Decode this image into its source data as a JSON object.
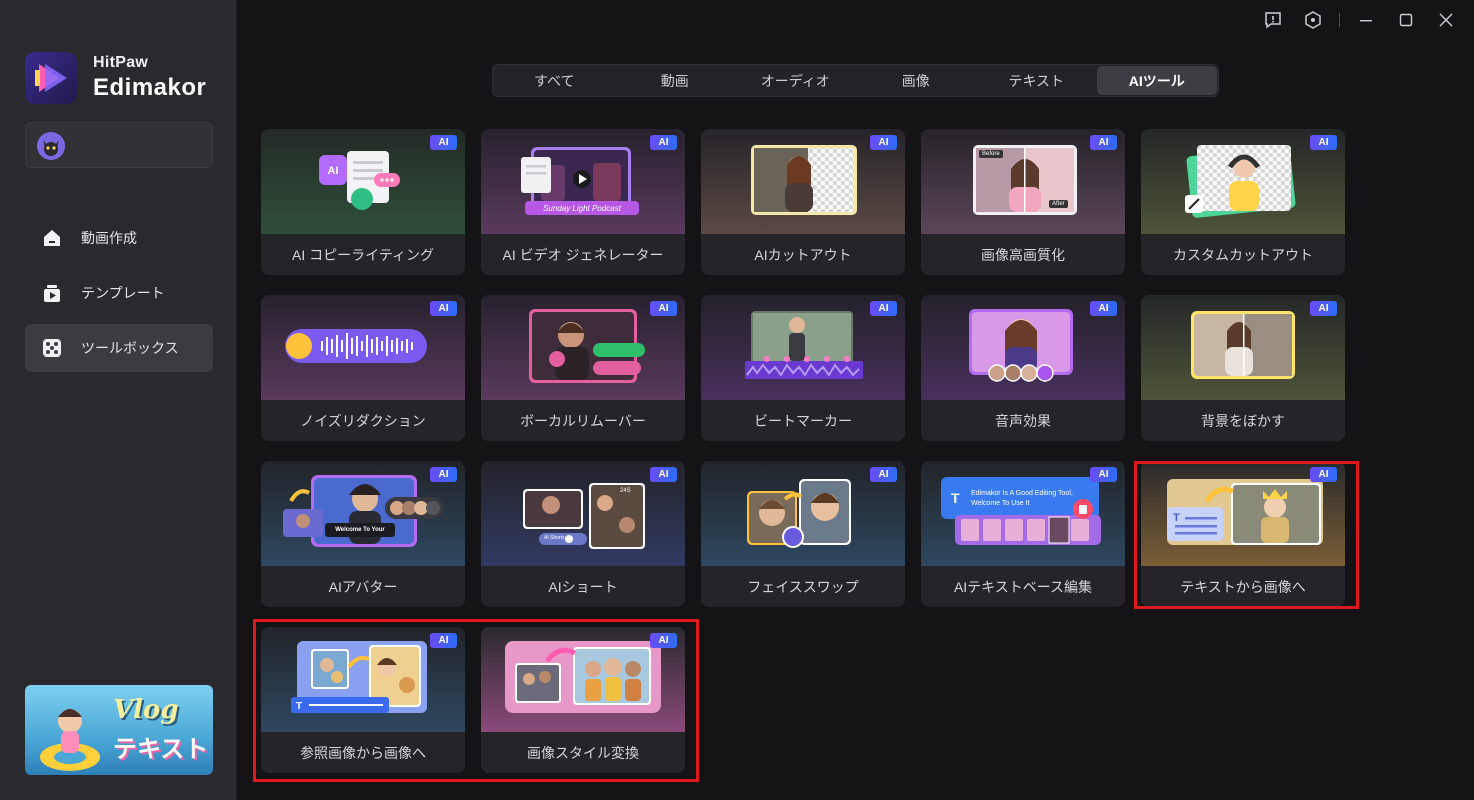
{
  "brand": {
    "small": "HitPaw",
    "big": "Edimakor"
  },
  "sidebar": {
    "items": [
      {
        "label": "動画作成",
        "icon": "home-icon",
        "active": false
      },
      {
        "label": "テンプレート",
        "icon": "template-icon",
        "active": false
      },
      {
        "label": "ツールボックス",
        "icon": "toolbox-icon",
        "active": true
      }
    ],
    "promo": {
      "title": "Vlog",
      "subtitle": "テキスト"
    }
  },
  "tabs": [
    {
      "label": "すべて",
      "active": false
    },
    {
      "label": "動画",
      "active": false
    },
    {
      "label": "オーディオ",
      "active": false
    },
    {
      "label": "画像",
      "active": false
    },
    {
      "label": "テキスト",
      "active": false
    },
    {
      "label": "AIツール",
      "active": true
    }
  ],
  "badge": "AI",
  "cards": [
    {
      "label": "AI コピーライティング",
      "theme": "green"
    },
    {
      "label": "AI ビデオ ジェネレーター",
      "theme": "purple",
      "caption": "Sunday Light Podcast"
    },
    {
      "label": "AIカットアウト",
      "theme": "brown"
    },
    {
      "label": "画像高画質化",
      "theme": "mauve",
      "before": "Before",
      "after": "After"
    },
    {
      "label": "カスタムカットアウト",
      "theme": "olive"
    },
    {
      "label": "ノイズリダクション",
      "theme": "purple"
    },
    {
      "label": "ボーカルリムーバー",
      "theme": "purple"
    },
    {
      "label": "ビートマーカー",
      "theme": "violet"
    },
    {
      "label": "音声効果",
      "theme": "violet"
    },
    {
      "label": "背景をぼかす",
      "theme": "olive"
    },
    {
      "label": "AIアバター",
      "theme": "blue",
      "caption": "Welcome To Your"
    },
    {
      "label": "AIショート",
      "theme": "indigo",
      "caption": "AI Shorts",
      "count": "24S"
    },
    {
      "label": "フェイススワップ",
      "theme": "blue"
    },
    {
      "label": "AIテキストベース編集",
      "theme": "blue",
      "caption": "Edimakor Is A Good Editing Tool, Welcome To Use It"
    },
    {
      "label": "テキストから画像へ",
      "theme": "gold"
    },
    {
      "label": "参照画像から画像へ",
      "theme": "blue"
    },
    {
      "label": "画像スタイル変換",
      "theme": "pink"
    }
  ],
  "colors": {
    "accent": "#6b4cf6",
    "highlight": "#e0191e",
    "ai_badge_end": "#2d6cf5"
  }
}
